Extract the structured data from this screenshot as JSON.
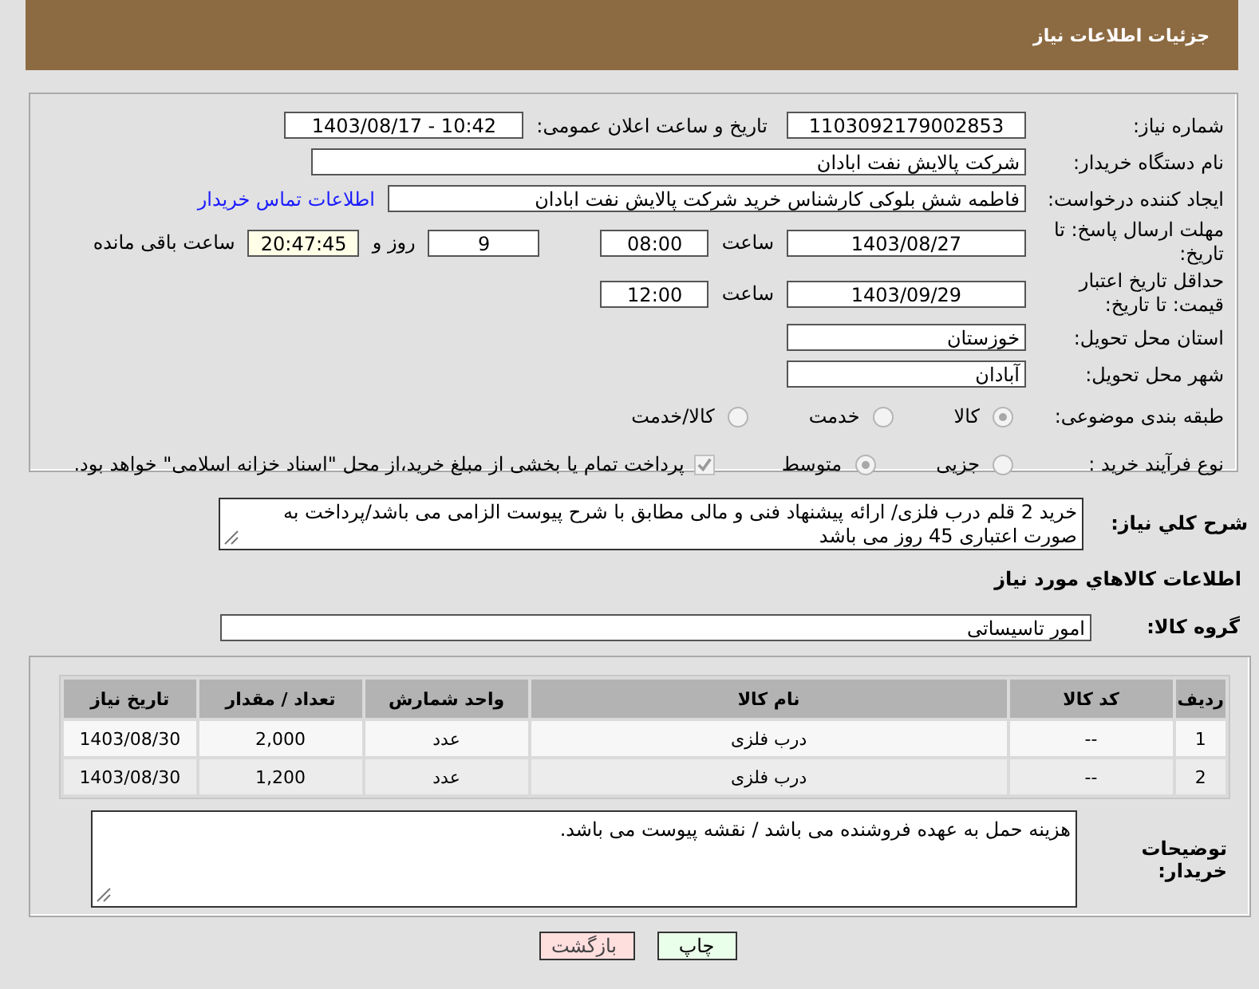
{
  "header": {
    "title": "جزئیات اطلاعات نیاز"
  },
  "form": {
    "need_number": {
      "label": "شماره نیاز:",
      "value": "1103092179002853"
    },
    "announce": {
      "label": "تاریخ و ساعت اعلان عمومی:",
      "value": "1403/08/17 - 10:42"
    },
    "buyer_org": {
      "label": "نام دستگاه خریدار:",
      "value": "شرکت پالایش نفت ابادان"
    },
    "requester": {
      "label": "ایجاد کننده درخواست:",
      "value": "فاطمه شش بلوکی کارشناس خرید شرکت پالایش نفت ابادان",
      "link": "اطلاعات تماس خریدار"
    },
    "reply_deadline": {
      "label": "مهلت ارسال پاسخ: تا تاریخ:",
      "date": "1403/08/27",
      "time_label": "ساعت",
      "time": "08:00",
      "days": "9",
      "days_label": "روز و",
      "remaining": "20:47:45",
      "remaining_label": "ساعت باقی مانده"
    },
    "price_validity": {
      "label": "حداقل تاریخ اعتبار قیمت: تا تاریخ:",
      "date": "1403/09/29",
      "time_label": "ساعت",
      "time": "12:00"
    },
    "province": {
      "label": "استان محل تحویل:",
      "value": "خوزستان"
    },
    "city": {
      "label": "شهر محل تحویل:",
      "value": "آبادان"
    },
    "category": {
      "label": "طبقه بندی موضوعی:",
      "options": [
        {
          "label": "کالا",
          "selected": true
        },
        {
          "label": "خدمت",
          "selected": false
        },
        {
          "label": "کالا/خدمت",
          "selected": false
        }
      ]
    },
    "process": {
      "label": "نوع فرآیند خرید :",
      "options": [
        {
          "label": "جزیی",
          "selected": false
        },
        {
          "label": "متوسط",
          "selected": true
        }
      ],
      "payment": {
        "checked": true,
        "text": "پرداخت تمام یا بخشی از مبلغ خرید،از محل \"اسناد خزانه اسلامی\" خواهد بود."
      }
    }
  },
  "description": {
    "label": "شرح کلي نياز:",
    "value": "خرید 2 قلم درب فلزی/ ارائه پیشنهاد فنی و مالی مطابق با شرح پیوست الزامی می باشد/پرداخت به صورت اعتباری 45 روز می باشد"
  },
  "goods_heading": "اطلاعات کالاهاي مورد نياز",
  "goods_group": {
    "label": "گروه کالا:",
    "value": "امور تاسیساتی"
  },
  "table": {
    "columns": [
      "ردیف",
      "کد کالا",
      "نام کالا",
      "واحد شمارش",
      "تعداد / مقدار",
      "تاریخ نیاز"
    ],
    "rows": [
      [
        "1",
        "--",
        "درب فلزی",
        "عدد",
        "2,000",
        "1403/08/30"
      ],
      [
        "2",
        "--",
        "درب فلزی",
        "عدد",
        "1,200",
        "1403/08/30"
      ]
    ]
  },
  "buyer_notes": {
    "label": "توضیحات خریدار:",
    "value": "هزینه حمل به عهده فروشنده می باشد / نقشه پیوست می باشد."
  },
  "buttons": [
    {
      "label": "چاپ",
      "kind": "print"
    },
    {
      "label": "بازگشت",
      "kind": "back"
    }
  ]
}
